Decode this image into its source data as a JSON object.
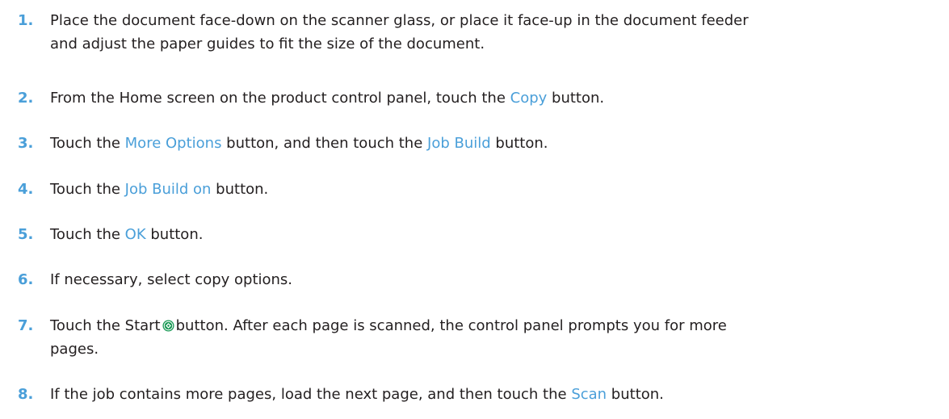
{
  "steps": [
    {
      "number": "1.",
      "line1": "Place the document face-down on the scanner glass, or place it face-up in the document feeder",
      "line2": "and adjust the paper guides to fit the size of the document."
    },
    {
      "number": "2.",
      "pre": "From the Home screen on the product control panel, touch the ",
      "link": "Copy",
      "post": " button."
    },
    {
      "number": "3.",
      "pre": "Touch the ",
      "link1": "More Options",
      "mid": " button, and then touch the ",
      "link2": "Job Build",
      "post": " button."
    },
    {
      "number": "4.",
      "pre": "Touch the ",
      "link": "Job Build on",
      "post": " button."
    },
    {
      "number": "5.",
      "pre": "Touch the ",
      "link": "OK",
      "post": " button."
    },
    {
      "number": "6.",
      "text": "If necessary, select copy options."
    },
    {
      "number": "7.",
      "pre": "Touch the Start",
      "icon": "start-icon",
      "post": "button. After each page is scanned, the control panel prompts you for more",
      "line2": "pages."
    },
    {
      "number": "8.",
      "pre": "If the job contains more pages, load the next page, and then touch the ",
      "link": "Scan",
      "post": " button."
    }
  ],
  "colors": {
    "accent": "#4a9fd9",
    "text": "#231f20",
    "start_icon": "#1a9a56"
  }
}
